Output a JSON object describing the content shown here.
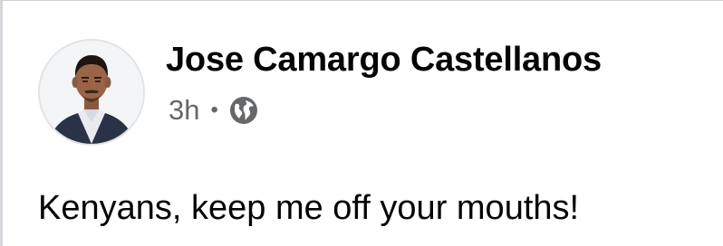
{
  "post": {
    "author_name": "Jose Camargo Castellanos",
    "timestamp": "3h",
    "separator": "•",
    "audience_icon": "globe-icon",
    "text": "Kenyans, keep me off your mouths!"
  },
  "colors": {
    "name": "#050505",
    "meta": "#65676b",
    "background": "#ffffff"
  }
}
